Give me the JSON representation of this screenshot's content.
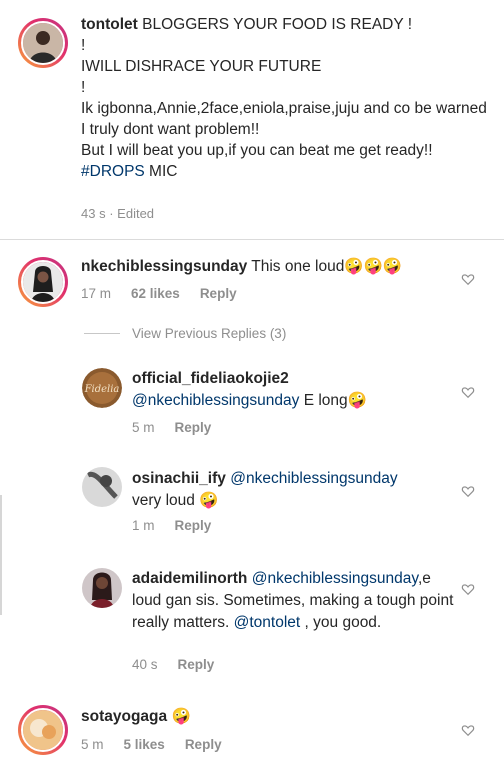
{
  "caption": {
    "username": "tontolet",
    "lines": [
      "BLOGGERS YOUR FOOD IS READY !",
      "!",
      "IWILL DISHRACE YOUR FUTURE",
      "!",
      "Ik igbonna,Annie,2face,eniola,praise,juju and co be warned I truly dont want problem!!",
      "But I will beat you up,if you can beat me get ready!!"
    ],
    "hashtag": "#DROPS",
    "tail": " MIC",
    "time": "43 s",
    "separator": "·",
    "edited": "Edited"
  },
  "comment1": {
    "username": "nkechiblessingsunday",
    "text": " This one loud🤪🤪🤪",
    "time": "17 m",
    "likes": "62 likes",
    "reply": "Reply"
  },
  "view_previous": "View Previous Replies (3)",
  "reply1": {
    "username": "official_fideliaokojie2",
    "mention": "@nkechiblessingsunday",
    "text": " E long🤪",
    "time": "5 m",
    "reply": "Reply"
  },
  "reply2": {
    "username": "osinachii_ify",
    "mention": "@nkechiblessingsunday",
    "text": "very loud 🤪",
    "time": "1 m",
    "reply": "Reply"
  },
  "reply3": {
    "username": "adaidemilinorth",
    "mention": "@nkechiblessingsunday",
    "text": ",e loud gan sis. Sometimes, making a tough point really matters. ",
    "mention2": "@tontolet",
    "text2": " , you good.",
    "time": "40 s",
    "reply": "Reply"
  },
  "comment2": {
    "username": "sotayogaga",
    "text": " 🤪",
    "time": "5 m",
    "likes": "5 likes",
    "reply": "Reply"
  },
  "icons": {
    "heart": "heart-outline-icon"
  },
  "colors": {
    "text": "#262626",
    "secondary": "#8e8e8e",
    "mention": "#00376b"
  }
}
